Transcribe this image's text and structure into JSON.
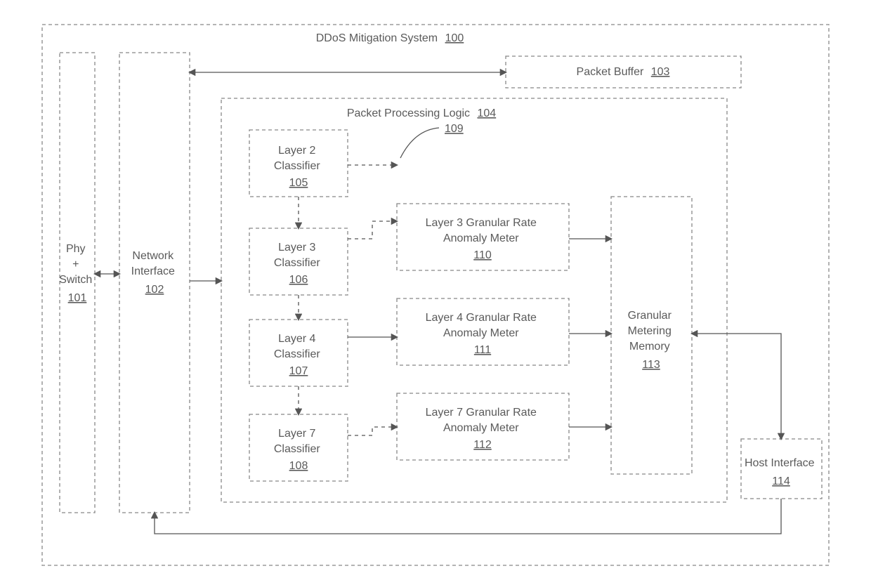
{
  "system": {
    "title": "DDoS Mitigation System",
    "ref": "100"
  },
  "phy_switch": {
    "line1": "Phy",
    "line2": "+",
    "line3": "Switch",
    "ref": "101"
  },
  "network_interface": {
    "line1": "Network",
    "line2": "Interface",
    "ref": "102"
  },
  "packet_buffer": {
    "label": "Packet Buffer",
    "ref": "103"
  },
  "ppl": {
    "title": "Packet Processing Logic",
    "ref": "104"
  },
  "classifiers": {
    "l2": {
      "line1": "Layer 2",
      "line2": "Classifier",
      "ref": "105"
    },
    "l3": {
      "line1": "Layer 3",
      "line2": "Classifier",
      "ref": "106"
    },
    "l4": {
      "line1": "Layer 4",
      "line2": "Classifier",
      "ref": "107"
    },
    "l7": {
      "line1": "Layer 7",
      "line2": "Classifier",
      "ref": "108"
    }
  },
  "hook": {
    "ref": "109"
  },
  "meters": {
    "l3": {
      "line1": "Layer 3 Granular Rate",
      "line2": "Anomaly Meter",
      "ref": "110"
    },
    "l4": {
      "line1": "Layer 4 Granular Rate",
      "line2": "Anomaly Meter",
      "ref": "111"
    },
    "l7": {
      "line1": "Layer 7 Granular Rate",
      "line2": "Anomaly Meter",
      "ref": "112"
    }
  },
  "granular_memory": {
    "line1": "Granular",
    "line2": "Metering",
    "line3": "Memory",
    "ref": "113"
  },
  "host_interface": {
    "line1": "Host Interface",
    "ref": "114"
  }
}
